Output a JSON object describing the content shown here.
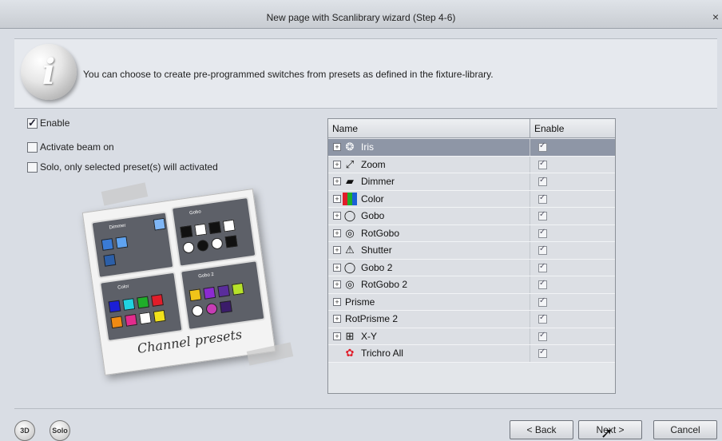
{
  "window": {
    "title": "New page with Scanlibrary wizard (Step 4-6)",
    "close_label": "×"
  },
  "banner": {
    "icon": "info-icon",
    "message": "You can choose to create pre-programmed switches from presets as defined in the fixture-library."
  },
  "options": [
    {
      "label": "Enable",
      "checked": true
    },
    {
      "label": "Activate beam on",
      "checked": false
    },
    {
      "label": "Solo, only selected preset(s) will activated",
      "checked": false
    }
  ],
  "artwork": {
    "caption": "Channel presets",
    "panel_labels": [
      "Dimmer",
      "Gobo",
      "Color",
      "Gobo 2"
    ]
  },
  "table": {
    "columns": [
      "Name",
      "Enable"
    ],
    "rows": [
      {
        "name": "Iris",
        "icon": "iris-icon",
        "expandable": true,
        "enabled": true,
        "selected": true
      },
      {
        "name": "Zoom",
        "icon": "zoom-icon",
        "expandable": true,
        "enabled": true
      },
      {
        "name": "Dimmer",
        "icon": "dimmer-icon",
        "expandable": true,
        "enabled": true
      },
      {
        "name": "Color",
        "icon": "color-icon",
        "expandable": true,
        "enabled": true
      },
      {
        "name": "Gobo",
        "icon": "gobo-icon",
        "expandable": true,
        "enabled": true
      },
      {
        "name": "RotGobo",
        "icon": "rotgobo-icon",
        "expandable": true,
        "enabled": true
      },
      {
        "name": "Shutter",
        "icon": "shutter-icon",
        "expandable": true,
        "enabled": true
      },
      {
        "name": "Gobo 2",
        "icon": "gobo-icon",
        "expandable": true,
        "enabled": true
      },
      {
        "name": "RotGobo 2",
        "icon": "rotgobo-icon",
        "expandable": true,
        "enabled": true
      },
      {
        "name": "Prisme",
        "icon": "",
        "expandable": true,
        "enabled": true
      },
      {
        "name": "RotPrisme 2",
        "icon": "",
        "expandable": true,
        "enabled": true
      },
      {
        "name": "X-Y",
        "icon": "xy-icon",
        "expandable": true,
        "enabled": true
      },
      {
        "name": "Trichro All",
        "icon": "trichro-icon",
        "expandable": false,
        "enabled": true
      }
    ]
  },
  "footer": {
    "btn_3d": "3D",
    "btn_solo": "Solo",
    "back": "< Back",
    "next": "Next >",
    "cancel": "Cancel"
  }
}
